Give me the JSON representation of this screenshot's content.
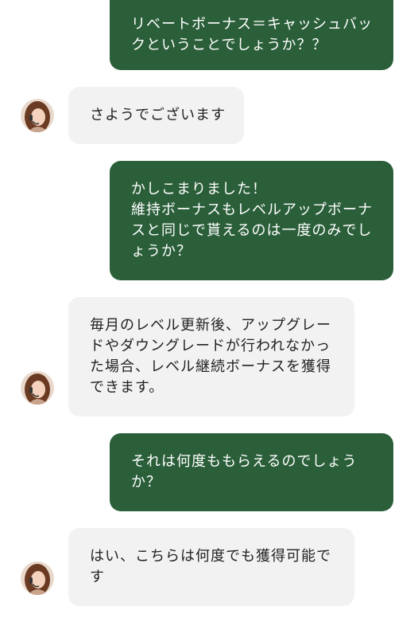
{
  "messages": [
    {
      "role": "user",
      "text": "リベートボーナス＝キャッシュバックということでしょうか？？"
    },
    {
      "role": "agent",
      "text": "さようでございます"
    },
    {
      "role": "user",
      "text": "かしこまりました！\n維持ボーナスもレベルアップボーナスと同じで貰えるのは一度のみでしょうか？"
    },
    {
      "role": "agent",
      "text": "毎月のレベル更新後、アップグレードやダウングレードが行われなかった場合、レベル継続ボーナスを獲得できます。"
    },
    {
      "role": "user",
      "text": "それは何度ももらえるのでしょうか？"
    },
    {
      "role": "agent",
      "text": "はい、こちらは何度でも獲得可能です"
    }
  ],
  "colors": {
    "user_bubble": "#2b5f3a",
    "agent_bubble": "#f2f2f2"
  },
  "icons": {
    "agent_avatar": "support-agent-headset-avatar"
  }
}
